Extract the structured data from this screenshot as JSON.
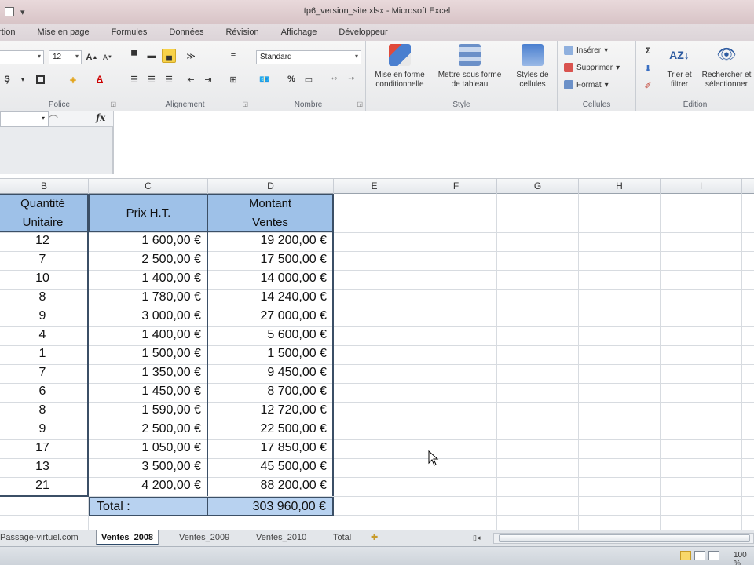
{
  "window": {
    "title": "tp6_version_site.xlsx - Microsoft Excel"
  },
  "ribbon_tabs": [
    "ertion",
    "Mise en page",
    "Formules",
    "Données",
    "Révision",
    "Affichage",
    "Développeur"
  ],
  "ribbon": {
    "font_size": "12",
    "number_format": "Standard",
    "percent_glyph": "%",
    "groups": {
      "police": "Police",
      "alignement": "Alignement",
      "nombre": "Nombre",
      "style": "Style",
      "cellules": "Cellules",
      "edition": "Édition"
    },
    "style_buttons": {
      "conditional_1": "Mise en forme",
      "conditional_2": "conditionnelle",
      "table_1": "Mettre sous forme",
      "table_2": "de tableau",
      "cellstyles_1": "Styles de",
      "cellstyles_2": "cellules"
    },
    "cells_buttons": {
      "insert": "Insérer",
      "delete": "Supprimer",
      "format": "Format"
    },
    "edit_buttons": {
      "sort_1": "Trier et",
      "sort_2": "filtrer",
      "find_1": "Rechercher et",
      "find_2": "sélectionner"
    }
  },
  "formula_bar": {
    "fx_label": "fx"
  },
  "columns": [
    "B",
    "C",
    "D",
    "E",
    "F",
    "G",
    "H",
    "I"
  ],
  "table": {
    "headers": {
      "b_line1": "Quantité",
      "b_line2": "Unitaire",
      "c": "Prix H.T.",
      "d_line1": "Montant",
      "d_line2": "Ventes"
    },
    "rows": [
      {
        "qty": "12",
        "price": "1 600,00 €",
        "amount": "19 200,00 €"
      },
      {
        "qty": "7",
        "price": "2 500,00 €",
        "amount": "17 500,00 €"
      },
      {
        "qty": "10",
        "price": "1 400,00 €",
        "amount": "14 000,00 €"
      },
      {
        "qty": "8",
        "price": "1 780,00 €",
        "amount": "14 240,00 €"
      },
      {
        "qty": "9",
        "price": "3 000,00 €",
        "amount": "27 000,00 €"
      },
      {
        "qty": "4",
        "price": "1 400,00 €",
        "amount": "5 600,00 €"
      },
      {
        "qty": "1",
        "price": "1 500,00 €",
        "amount": "1 500,00 €"
      },
      {
        "qty": "7",
        "price": "1 350,00 €",
        "amount": "9 450,00 €"
      },
      {
        "qty": "6",
        "price": "1 450,00 €",
        "amount": "8 700,00 €"
      },
      {
        "qty": "8",
        "price": "1 590,00 €",
        "amount": "12 720,00 €"
      },
      {
        "qty": "9",
        "price": "2 500,00 €",
        "amount": "22 500,00 €"
      },
      {
        "qty": "17",
        "price": "1 050,00 €",
        "amount": "17 850,00 €"
      },
      {
        "qty": "13",
        "price": "3 500,00 €",
        "amount": "45 500,00 €"
      },
      {
        "qty": "21",
        "price": "4 200,00 €",
        "amount": "88 200,00 €"
      }
    ],
    "total_label": "Total :",
    "total_value": "303 960,00 €"
  },
  "sheet_tabs": [
    "Passage-virtuel.com",
    "Ventes_2008",
    "Ventes_2009",
    "Ventes_2010",
    "Total"
  ],
  "active_sheet": "Ventes_2008",
  "status": {
    "zoom": "100 %"
  }
}
